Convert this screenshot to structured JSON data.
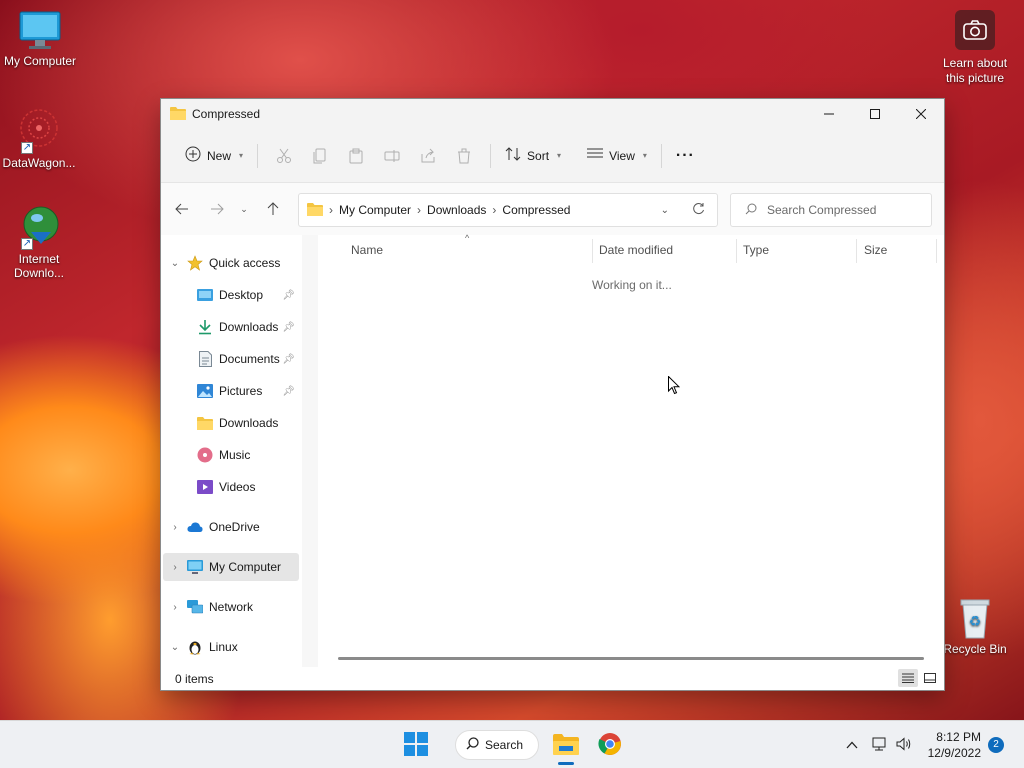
{
  "desktop": {
    "icons": [
      {
        "label": "My Computer"
      },
      {
        "label": "DataWagon..."
      },
      {
        "label": "Internet Downlo..."
      },
      {
        "label": "Recycle Bin"
      }
    ],
    "learn_label": "Learn about this picture"
  },
  "window": {
    "title": "Compressed",
    "toolbar": {
      "new_label": "New",
      "sort_label": "Sort",
      "view_label": "View",
      "more_label": "···"
    },
    "address": {
      "crumbs": [
        "My Computer",
        "Downloads",
        "Compressed"
      ]
    },
    "search": {
      "placeholder": "Search Compressed"
    },
    "sidebar": {
      "items": [
        {
          "label": "Quick access",
          "icon": "star-icon"
        },
        {
          "label": "Desktop",
          "icon": "desktop-folder-icon"
        },
        {
          "label": "Downloads",
          "icon": "download-icon"
        },
        {
          "label": "Documents",
          "icon": "document-icon"
        },
        {
          "label": "Pictures",
          "icon": "pictures-icon"
        },
        {
          "label": "Downloads",
          "icon": "folder-icon"
        },
        {
          "label": "Music",
          "icon": "music-icon"
        },
        {
          "label": "Videos",
          "icon": "videos-icon"
        },
        {
          "label": "OneDrive",
          "icon": "cloud-icon"
        },
        {
          "label": "My Computer",
          "icon": "computer-icon"
        },
        {
          "label": "Network",
          "icon": "network-icon"
        },
        {
          "label": "Linux",
          "icon": "linux-icon"
        }
      ]
    },
    "columns": [
      "Name",
      "Date modified",
      "Type",
      "Size"
    ],
    "status_message": "Working on it...",
    "status_count": "0 items"
  },
  "taskbar": {
    "search_label": "Search",
    "time": "8:12 PM",
    "date": "12/9/2022",
    "notification_count": "2"
  },
  "colors": {
    "accent": "#0f6cbd",
    "folder_yellow": "#f4c542",
    "selected_bg": "#e5e5e5"
  }
}
